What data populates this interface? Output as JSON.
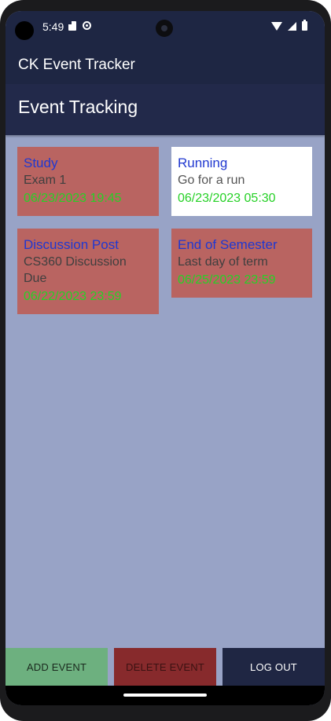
{
  "status_bar": {
    "time": "5:49"
  },
  "app_bar": {
    "title": "CK Event Tracker"
  },
  "sub_header": {
    "title": "Event Tracking"
  },
  "events": [
    {
      "title": "Study",
      "description": "Exam 1",
      "datetime": "06/23/2023 19:45",
      "color": "#b96461"
    },
    {
      "title": "Running",
      "description": "Go for a run",
      "datetime": "06/23/2023 05:30",
      "color": "#ffffff"
    },
    {
      "title": "Discussion Post",
      "description": "CS360 Discussion Due",
      "datetime": "06/22/2023 23:59",
      "color": "#b96461"
    },
    {
      "title": "End of Semester",
      "description": "Last day of term",
      "datetime": "06/25/2023 23:59",
      "color": "#b96461"
    }
  ],
  "buttons": {
    "add": "ADD EVENT",
    "delete": "DELETE EVENT",
    "logout": "LOG OUT"
  }
}
